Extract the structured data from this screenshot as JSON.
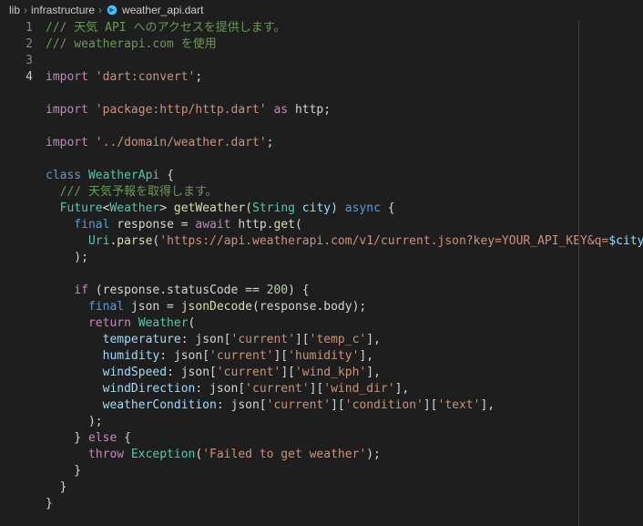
{
  "breadcrumb": {
    "segments": [
      "lib",
      "infrastructure"
    ],
    "file": "weather_api.dart",
    "sep": "›"
  },
  "gutter": {
    "lines": [
      "1",
      "2",
      "3",
      "4"
    ],
    "active_index": 3
  },
  "code": {
    "l1_1": "/// 天気 API へのアクセスを提供します。",
    "l2_1": "/// weatherapi.com を使用",
    "l4_kw": "import",
    "l4_str": "'dart:convert'",
    "l4_semi": ";",
    "l6_kw": "import",
    "l6_str": "'package:http/http.dart'",
    "l6_as": " as ",
    "l6_ns": "http;",
    "l8_kw": "import",
    "l8_str": "'../domain/weather.dart'",
    "l8_semi": ";",
    "l10_kw": "class",
    "l10_cls": " WeatherApi ",
    "l10_brace": "{",
    "l11": "  /// 天気予報を取得します。",
    "l12_ret": "  Future",
    "l12_lt": "<",
    "l12_w": "Weather",
    "l12_gt": "> ",
    "l12_fn": "getWeather",
    "l12_par": "(",
    "l12_ptype": "String",
    "l12_pname": " city) ",
    "l12_async": "async",
    "l12_brace": " {",
    "l13_a": "    final",
    "l13_b": " response = ",
    "l13_c": "await",
    "l13_d": " http.",
    "l13_e": "get",
    "l13_f": "(",
    "l14_a": "      Uri",
    "l14_b": ".",
    "l14_c": "parse",
    "l14_d": "(",
    "l14_e": "'https://api.weatherapi.com/v1/current.json?key=YOUR_API_KEY&q=",
    "l14_f": "$city",
    "l14_g": "'",
    "l14_h": "),",
    "l15": "    );",
    "l17_a": "    if",
    "l17_b": " (response.statusCode == ",
    "l17_c": "200",
    "l17_d": ") {",
    "l18_a": "      final",
    "l18_b": " json = ",
    "l18_c": "jsonDecode",
    "l18_d": "(response.body);",
    "l19_a": "      return",
    "l19_b": " Weather",
    "l19_c": "(",
    "l20_a": "        temperature",
    "l20_b": ": json[",
    "l20_c": "'current'",
    "l20_d": "][",
    "l20_e": "'temp_c'",
    "l20_f": "],",
    "l21_a": "        humidity",
    "l21_b": ": json[",
    "l21_c": "'current'",
    "l21_d": "][",
    "l21_e": "'humidity'",
    "l21_f": "],",
    "l22_a": "        windSpeed",
    "l22_b": ": json[",
    "l22_c": "'current'",
    "l22_d": "][",
    "l22_e": "'wind_kph'",
    "l22_f": "],",
    "l23_a": "        windDirection",
    "l23_b": ": json[",
    "l23_c": "'current'",
    "l23_d": "][",
    "l23_e": "'wind_dir'",
    "l23_f": "],",
    "l24_a": "        weatherCondition",
    "l24_b": ": json[",
    "l24_c": "'current'",
    "l24_d": "][",
    "l24_e": "'condition'",
    "l24_f": "][",
    "l24_g": "'text'",
    "l24_h": "],",
    "l25": "      );",
    "l26_a": "    } ",
    "l26_b": "else",
    "l26_c": " {",
    "l27_a": "      throw",
    "l27_b": " Exception",
    "l27_c": "(",
    "l27_d": "'Failed to get weather'",
    "l27_e": ");",
    "l28": "    }",
    "l29": "  }",
    "l30": "}"
  }
}
